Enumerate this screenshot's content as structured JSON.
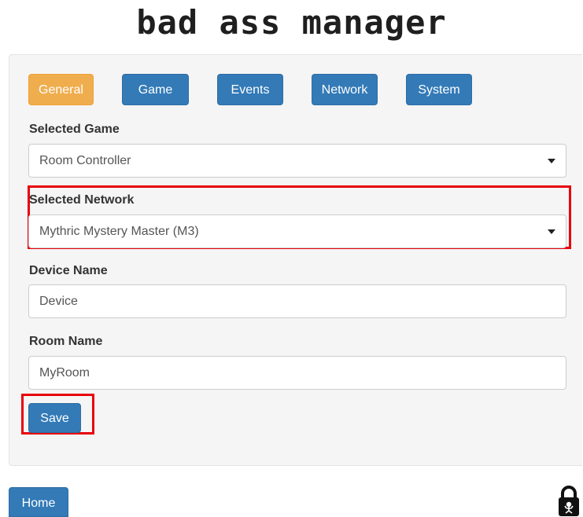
{
  "app": {
    "title": "bad ass manager"
  },
  "tabs": [
    {
      "label": "General",
      "active": true
    },
    {
      "label": "Game",
      "active": false
    },
    {
      "label": "Events",
      "active": false
    },
    {
      "label": "Network",
      "active": false
    },
    {
      "label": "System",
      "active": false
    }
  ],
  "form": {
    "selected_game": {
      "label": "Selected Game",
      "value": "Room Controller"
    },
    "selected_network": {
      "label": "Selected Network",
      "value": "Mythric Mystery Master (M3)"
    },
    "device_name": {
      "label": "Device Name",
      "value": "Device"
    },
    "room_name": {
      "label": "Room Name",
      "value": "MyRoom"
    },
    "save_label": "Save"
  },
  "footer": {
    "home_label": "Home",
    "lock_icon": "padlock-icon"
  },
  "colors": {
    "active_tab": "#f0ad4e",
    "primary": "#337ab7",
    "highlight": "#e8000b",
    "panel_bg": "#f5f5f5"
  }
}
